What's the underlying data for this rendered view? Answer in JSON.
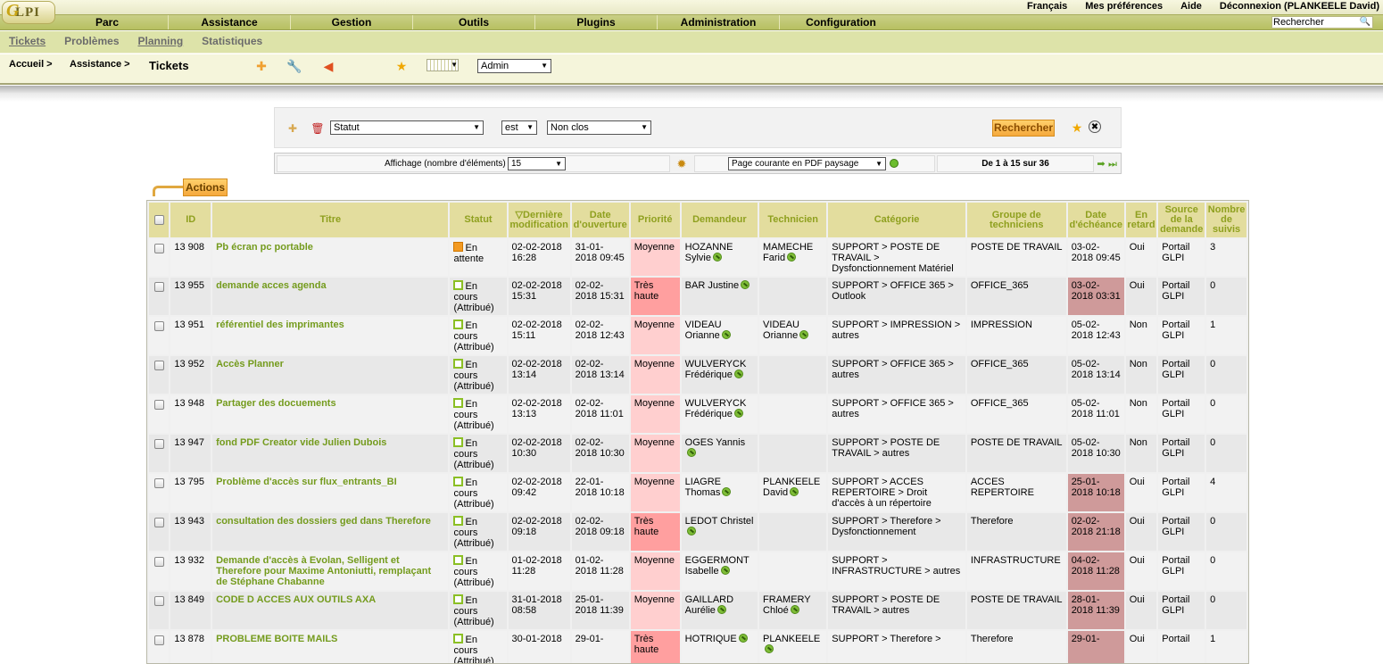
{
  "app": {
    "logo_text": "LPI",
    "logo_g": "G"
  },
  "prefs": {
    "lang": "Français",
    "prefs": "Mes préférences",
    "help": "Aide",
    "logout": "Déconnexion (PLANKEELE David)"
  },
  "menu": {
    "items": [
      "Parc",
      "Assistance",
      "Gestion",
      "Outils",
      "Plugins",
      "Administration",
      "Configuration"
    ]
  },
  "search": {
    "value": "Rechercher"
  },
  "submenu": {
    "items": [
      "Tickets",
      "Problèmes",
      "Planning",
      "Statistiques"
    ]
  },
  "breadcrumb": {
    "home": "Accueil >",
    "section": "Assistance >",
    "title": "Tickets"
  },
  "entity_select": {
    "value": "Admin"
  },
  "criteria": {
    "field": "Statut",
    "operator": "est",
    "value": "Non clos",
    "search_button": "Rechercher"
  },
  "pager": {
    "display_label": "Affichage (nombre d'éléments)",
    "display_value": "15",
    "export_value": "Page courante en PDF paysage",
    "range": "De 1 à 15 sur 36"
  },
  "actions": {
    "label": "Actions"
  },
  "colors": {
    "header_bg": "#e3dd9e",
    "header_text": "#8fa01f",
    "title_link": "#749b1d",
    "prio_medium": "#ffcfcf",
    "prio_high": "#ff9f9f",
    "overdue": "#cf9a9a"
  },
  "table": {
    "headers": [
      "ID",
      "Titre",
      "Statut",
      "▽Dernière modification",
      "Date d'ouverture",
      "Priorité",
      "Demandeur",
      "Technicien",
      "Catégorie",
      "Groupe de techniciens",
      "Date d'échéance",
      "En retard",
      "Source de la demande",
      "Nombre de suivis"
    ],
    "rows": [
      {
        "id": "13 908",
        "title": "Pb écran pc portable",
        "status": "En attente",
        "status_type": "wait",
        "modified": "02-02-2018 16:28",
        "opened": "31-01-2018 09:45",
        "priority": "Moyenne",
        "prio_level": "medium",
        "requester": "HOZANNE Sylvie",
        "tech": "MAMECHE Farid",
        "category": "SUPPORT > POSTE DE TRAVAIL > Dysfonctionnement Matériel",
        "group": "POSTE DE TRAVAIL",
        "due": "03-02-2018 09:45",
        "overdue": false,
        "late": "Oui",
        "source": "Portail GLPI",
        "followups": "3"
      },
      {
        "id": "13 955",
        "title": "demande acces agenda",
        "status": "En cours (Attribué)",
        "status_type": "prog",
        "modified": "02-02-2018 15:31",
        "opened": "02-02-2018 15:31",
        "priority": "Très haute",
        "prio_level": "high",
        "requester": "BAR Justine",
        "tech": "",
        "category": "SUPPORT > OFFICE 365 > Outlook",
        "group": "OFFICE_365",
        "due": "03-02-2018 03:31",
        "overdue": true,
        "late": "Oui",
        "source": "Portail GLPI",
        "followups": "0"
      },
      {
        "id": "13 951",
        "title": "référentiel des imprimantes",
        "status": "En cours (Attribué)",
        "status_type": "prog",
        "modified": "02-02-2018 15:11",
        "opened": "02-02-2018 12:43",
        "priority": "Moyenne",
        "prio_level": "medium",
        "requester": "VIDEAU Orianne",
        "tech": "VIDEAU Orianne",
        "category": "SUPPORT > IMPRESSION > autres",
        "group": "IMPRESSION",
        "due": "05-02-2018 12:43",
        "overdue": false,
        "late": "Non",
        "source": "Portail GLPI",
        "followups": "1"
      },
      {
        "id": "13 952",
        "title": "Accès Planner",
        "status": "En cours (Attribué)",
        "status_type": "prog",
        "modified": "02-02-2018 13:14",
        "opened": "02-02-2018 13:14",
        "priority": "Moyenne",
        "prio_level": "medium",
        "requester": "WULVERYCK Frédérique",
        "tech": "",
        "category": "SUPPORT > OFFICE 365 > autres",
        "group": "OFFICE_365",
        "due": "05-02-2018 13:14",
        "overdue": false,
        "late": "Non",
        "source": "Portail GLPI",
        "followups": "0"
      },
      {
        "id": "13 948",
        "title": "Partager des docuements",
        "status": "En cours (Attribué)",
        "status_type": "prog",
        "modified": "02-02-2018 13:13",
        "opened": "02-02-2018 11:01",
        "priority": "Moyenne",
        "prio_level": "medium",
        "requester": "WULVERYCK Frédérique",
        "tech": "",
        "category": "SUPPORT > OFFICE 365 > autres",
        "group": "OFFICE_365",
        "due": "05-02-2018 11:01",
        "overdue": false,
        "late": "Non",
        "source": "Portail GLPI",
        "followups": "0"
      },
      {
        "id": "13 947",
        "title": "fond PDF Creator vide Julien Dubois",
        "status": "En cours (Attribué)",
        "status_type": "prog",
        "modified": "02-02-2018 10:30",
        "opened": "02-02-2018 10:30",
        "priority": "Moyenne",
        "prio_level": "medium",
        "requester": "OGES Yannis",
        "tech": "",
        "category": "SUPPORT > POSTE DE TRAVAIL > autres",
        "group": "POSTE DE TRAVAIL",
        "due": "05-02-2018 10:30",
        "overdue": false,
        "late": "Non",
        "source": "Portail GLPI",
        "followups": "0"
      },
      {
        "id": "13 795",
        "title": "Problème d'accès sur flux_entrants_BI",
        "status": "En cours (Attribué)",
        "status_type": "prog",
        "modified": "02-02-2018 09:42",
        "opened": "22-01-2018 10:18",
        "priority": "Moyenne",
        "prio_level": "medium",
        "requester": "LIAGRE Thomas",
        "tech": "PLANKEELE David",
        "category": "SUPPORT > ACCES REPERTOIRE > Droit d'accès à un répertoire",
        "group": "ACCES REPERTOIRE",
        "due": "25-01-2018 10:18",
        "overdue": true,
        "late": "Oui",
        "source": "Portail GLPI",
        "followups": "4"
      },
      {
        "id": "13 943",
        "title": "consultation des dossiers ged dans Therefore",
        "status": "En cours (Attribué)",
        "status_type": "prog",
        "modified": "02-02-2018 09:18",
        "opened": "02-02-2018 09:18",
        "priority": "Très haute",
        "prio_level": "high",
        "requester": "LEDOT Christel",
        "tech": "",
        "category": "SUPPORT > Therefore > Dysfonctionnement",
        "group": "Therefore",
        "due": "02-02-2018 21:18",
        "overdue": true,
        "late": "Oui",
        "source": "Portail GLPI",
        "followups": "0"
      },
      {
        "id": "13 932",
        "title": "Demande d'accès à Evolan, Selligent et Therefore pour Maxime Antoniutti, remplaçant de Stéphane Chabanne",
        "status": "En cours (Attribué)",
        "status_type": "prog",
        "modified": "01-02-2018 11:28",
        "opened": "01-02-2018 11:28",
        "priority": "Moyenne",
        "prio_level": "medium",
        "requester": "EGGERMONT Isabelle",
        "tech": "",
        "category": "SUPPORT > INFRASTRUCTURE > autres",
        "group": "INFRASTRUCTURE",
        "due": "04-02-2018 11:28",
        "overdue": true,
        "late": "Oui",
        "source": "Portail GLPI",
        "followups": "0"
      },
      {
        "id": "13 849",
        "title": "CODE D ACCES AUX OUTILS AXA",
        "status": "En cours (Attribué)",
        "status_type": "prog",
        "modified": "31-01-2018 08:58",
        "opened": "25-01-2018 11:39",
        "priority": "Moyenne",
        "prio_level": "medium",
        "requester": "GAILLARD Aurélie",
        "tech": "FRAMERY Chloé",
        "category": "SUPPORT > POSTE DE TRAVAIL > autres",
        "group": "POSTE DE TRAVAIL",
        "due": "28-01-2018 11:39",
        "overdue": true,
        "late": "Oui",
        "source": "Portail GLPI",
        "followups": "0"
      },
      {
        "id": "13 878",
        "title": "PROBLEME BOITE MAILS",
        "status": "En cours (Attribué)",
        "status_type": "prog",
        "modified": "30-01-2018",
        "opened": "29-01-",
        "priority": "Très haute",
        "prio_level": "high",
        "requester": "HOTRIQUE",
        "tech": "PLANKEELE",
        "category": "SUPPORT > Therefore >",
        "group": "Therefore",
        "due": "29-01-",
        "overdue": true,
        "late": "Oui",
        "source": "Portail",
        "followups": "1"
      }
    ]
  }
}
